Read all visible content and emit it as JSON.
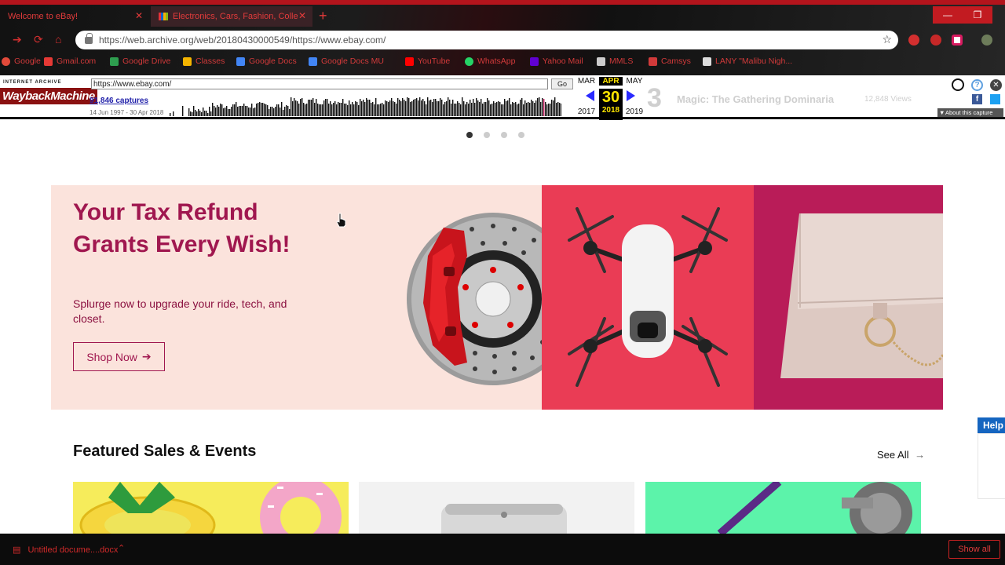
{
  "browser": {
    "tabs": [
      {
        "title": "Welcome to eBay!"
      },
      {
        "title": "Electronics, Cars, Fashion, Colle"
      }
    ],
    "address": "https://web.archive.org/web/20180430000549/https://www.ebay.com/",
    "bookmarks": [
      {
        "label": "Google",
        "icon": "google-icon",
        "color": "#e24a3a"
      },
      {
        "label": "Gmail.com",
        "icon": "gmail-icon",
        "color": "#e53935"
      },
      {
        "label": "Google Drive",
        "icon": "drive-icon",
        "color": "#2e9e4f"
      },
      {
        "label": "Classes",
        "icon": "classroom-icon",
        "color": "#f4b400"
      },
      {
        "label": "Google Docs",
        "icon": "docs-icon",
        "color": "#4285f4"
      },
      {
        "label": "Google Docs MU",
        "icon": "docs-icon",
        "color": "#4285f4"
      },
      {
        "label": "YouTube",
        "icon": "youtube-icon",
        "color": "#ff0000"
      },
      {
        "label": "WhatsApp",
        "icon": "whatsapp-icon",
        "color": "#25d366"
      },
      {
        "label": "Yahoo Mail",
        "icon": "mail-icon",
        "color": "#6001d2"
      },
      {
        "label": "MMLS",
        "icon": "mmls-icon",
        "color": "#cccccc"
      },
      {
        "label": "Camsys",
        "icon": "page-icon",
        "color": "#d13a3a"
      },
      {
        "label": "LANY \"Malibu Nigh...",
        "icon": "page-icon",
        "color": "#dddddd"
      }
    ]
  },
  "wayback": {
    "logo_top": "INTERNET ARCHIVE",
    "logo_main": "WaybackMachine",
    "url_value": "https://www.ebay.com/",
    "go_label": "Go",
    "captures": "91,846 captures",
    "range": "14 Jun 1997 - 30 Apr 2018",
    "prev_month": "MAR",
    "cur_month": "APR",
    "next_month": "MAY",
    "day": "30",
    "prev_year": "2017",
    "cur_year": "2018",
    "next_year": "2019",
    "about": "About this capture"
  },
  "ghost": {
    "rank": "3",
    "headline": "Magic: The Gathering Dominaria",
    "views": "12,848 Views"
  },
  "carousel": {
    "count": 4,
    "active": 0
  },
  "hero": {
    "headline": "Your Tax Refund Grants Every Wish!",
    "subtext": "Splurge now to upgrade your ride, tech, and closet.",
    "cta": "Shop Now",
    "colors": {
      "bg": "#fbe3dc",
      "accent": "#a0174f",
      "red_panel": "#ea3c55",
      "magenta_panel": "#b91c58"
    }
  },
  "featured": {
    "title": "Featured Sales & Events",
    "see_all": "See All"
  },
  "help": {
    "label": "Help"
  },
  "downloads": {
    "file": "Untitled docume....docx",
    "show_all": "Show all"
  }
}
